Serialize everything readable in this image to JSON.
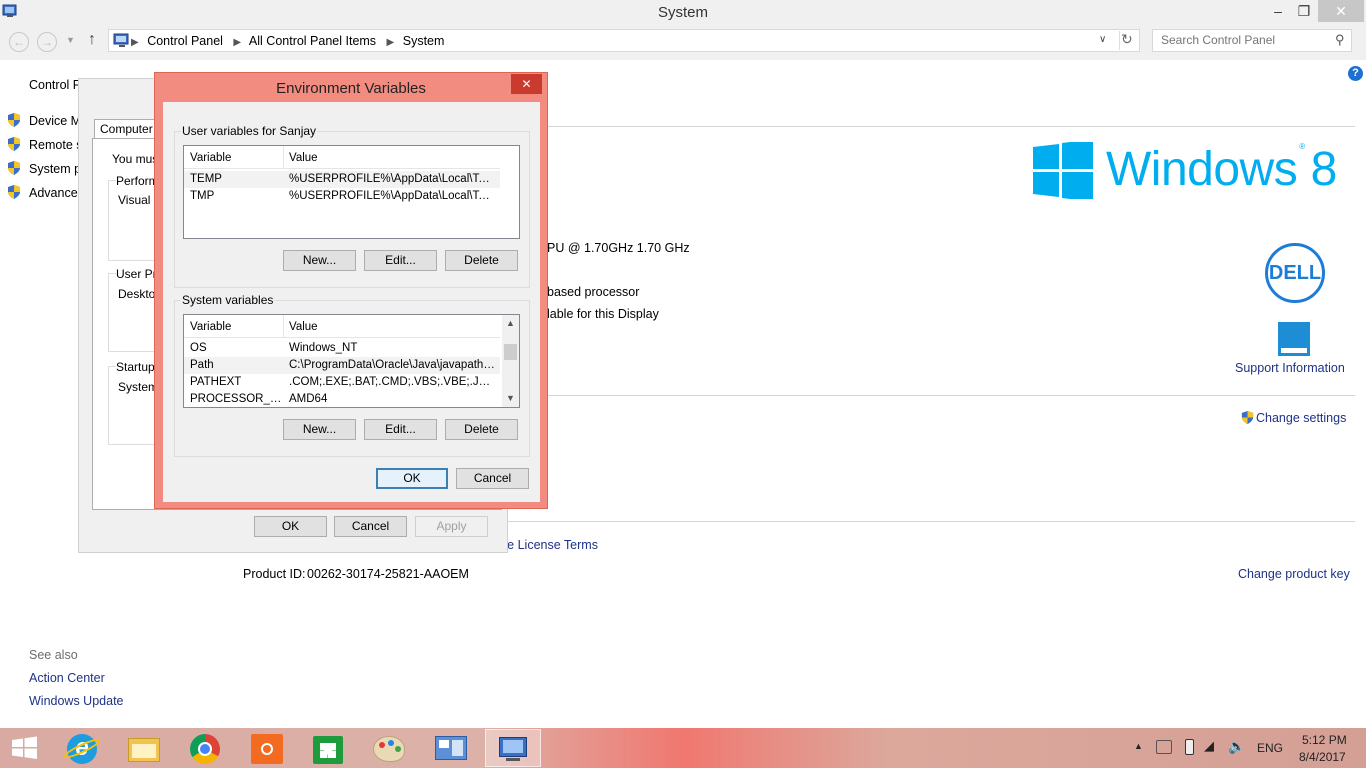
{
  "window": {
    "title": "System",
    "minimize": "–",
    "maximize": "❐",
    "close": "✕"
  },
  "address": {
    "crumbs": [
      "Control Panel",
      "All Control Panel Items",
      "System"
    ],
    "search_placeholder": "Search Control Panel"
  },
  "left_nav": {
    "home": "Control P",
    "items": [
      "Device M",
      "Remote s",
      "System p",
      "Advanced"
    ]
  },
  "see_also": {
    "heading": "See also",
    "links": [
      "Action Center",
      "Windows Update"
    ]
  },
  "system_info": {
    "windows_logo_text": "Windows",
    "windows_version": "8",
    "processor_text": "PU @ 1.70GHz   1.70 GHz",
    "system_type": "based processor",
    "pen_touch": "lable for this Display",
    "support_info": "Support Information",
    "change_settings": "Change settings",
    "license_terms": "re License Terms",
    "product_id_label": "Product ID:",
    "product_id": "00262-30174-25821-AAOEM",
    "change_key": "Change product key",
    "dell_logo": "DELL"
  },
  "sys_props": {
    "tab": "Computer N",
    "must_text": "You must",
    "perf_label": "Performa",
    "visual_text": "Visual e",
    "user_profiles_label": "User Pro",
    "desktop_text": "Desktop",
    "startup_label": "Startup a",
    "system_text": "System",
    "ok": "OK",
    "cancel": "Cancel",
    "apply": "Apply"
  },
  "env_dialog": {
    "title": "Environment Variables",
    "close": "✕",
    "user_group_title": "User variables for Sanjay",
    "system_group_title": "System variables",
    "col_variable": "Variable",
    "col_value": "Value",
    "user_vars": [
      {
        "name": "TEMP",
        "value": "%USERPROFILE%\\AppData\\Local\\Temp"
      },
      {
        "name": "TMP",
        "value": "%USERPROFILE%\\AppData\\Local\\Temp"
      }
    ],
    "system_vars": [
      {
        "name": "OS",
        "value": "Windows_NT"
      },
      {
        "name": "Path",
        "value": "C:\\ProgramData\\Oracle\\Java\\javapath;..."
      },
      {
        "name": "PATHEXT",
        "value": ".COM;.EXE;.BAT;.CMD;.VBS;.VBE;.JS;...."
      },
      {
        "name": "PROCESSOR_A...",
        "value": "AMD64"
      }
    ],
    "new_btn": "New...",
    "edit_btn": "Edit...",
    "delete_btn": "Delete",
    "ok_btn": "OK",
    "cancel_btn": "Cancel"
  },
  "taskbar": {
    "apps": [
      "start",
      "internet-explorer",
      "file-explorer",
      "chrome",
      "app-orange",
      "store",
      "paint",
      "control-panel",
      "system-window"
    ],
    "language": "ENG",
    "time": "5:12 PM",
    "date": "8/4/2017"
  },
  "colors": {
    "accent_blue": "#00adef",
    "link_blue": "#1e3287",
    "dialog_frame": "#f38c80",
    "close_red": "#c83b2e"
  }
}
